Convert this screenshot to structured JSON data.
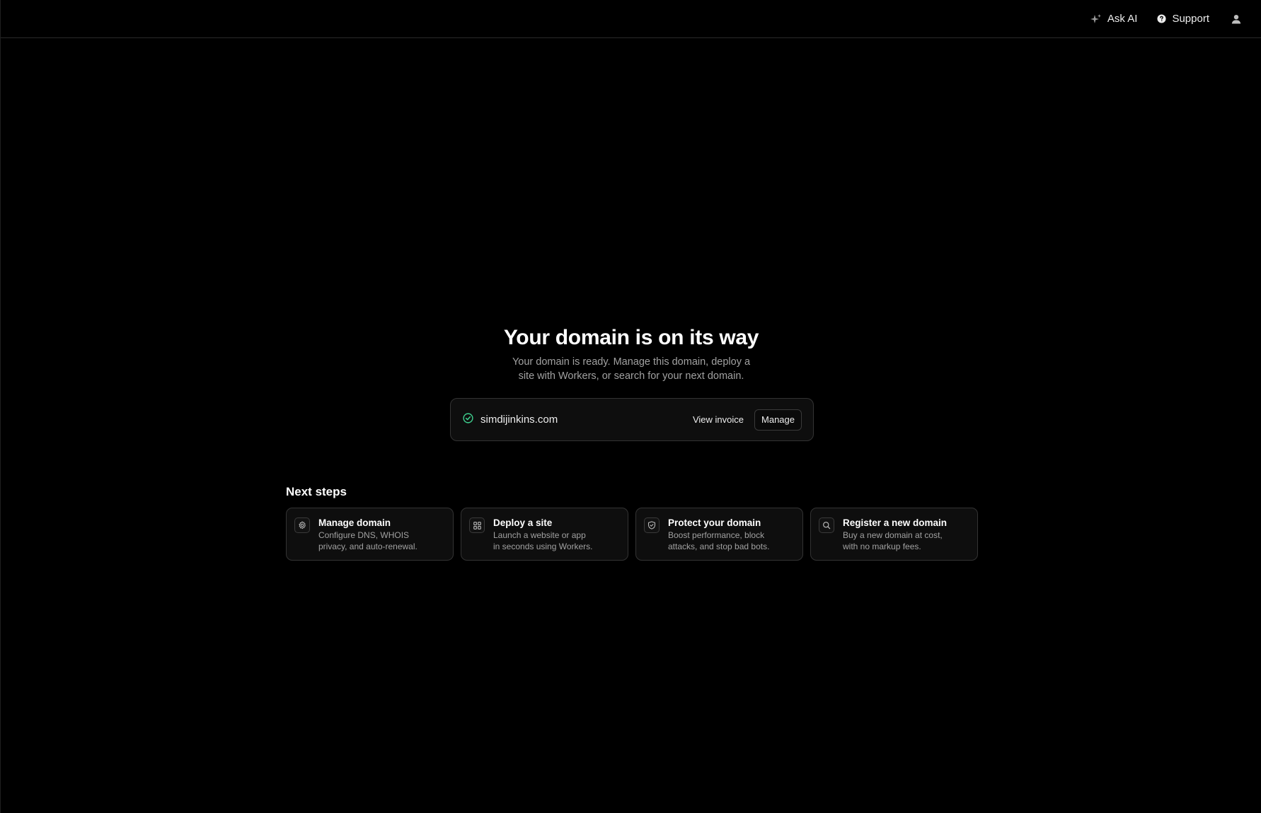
{
  "topbar": {
    "ask_ai_label": "Ask AI",
    "support_label": "Support"
  },
  "hero": {
    "title": "Your domain is on its way",
    "subtitle": "Your domain is ready. Manage this domain, deploy a site with Workers, or search for your next domain."
  },
  "domain_card": {
    "status_icon": "check-circle-icon",
    "status_color": "#3ecf8e",
    "domain": "simdijinkins.com",
    "view_invoice_label": "View invoice",
    "manage_label": "Manage"
  },
  "next_steps": {
    "heading": "Next steps",
    "items": [
      {
        "icon": "gear-icon",
        "title": "Manage domain",
        "description": "Configure DNS, WHOIS\nprivacy, and auto-renewal."
      },
      {
        "icon": "grid-icon",
        "title": "Deploy a site",
        "description": "Launch a website or app\nin seconds using Workers."
      },
      {
        "icon": "shield-icon",
        "title": "Protect your domain",
        "description": "Boost performance, block\nattacks, and stop bad bots."
      },
      {
        "icon": "search-icon",
        "title": "Register a new domain",
        "description": "Buy a new domain at cost,\nwith no markup fees."
      }
    ]
  }
}
